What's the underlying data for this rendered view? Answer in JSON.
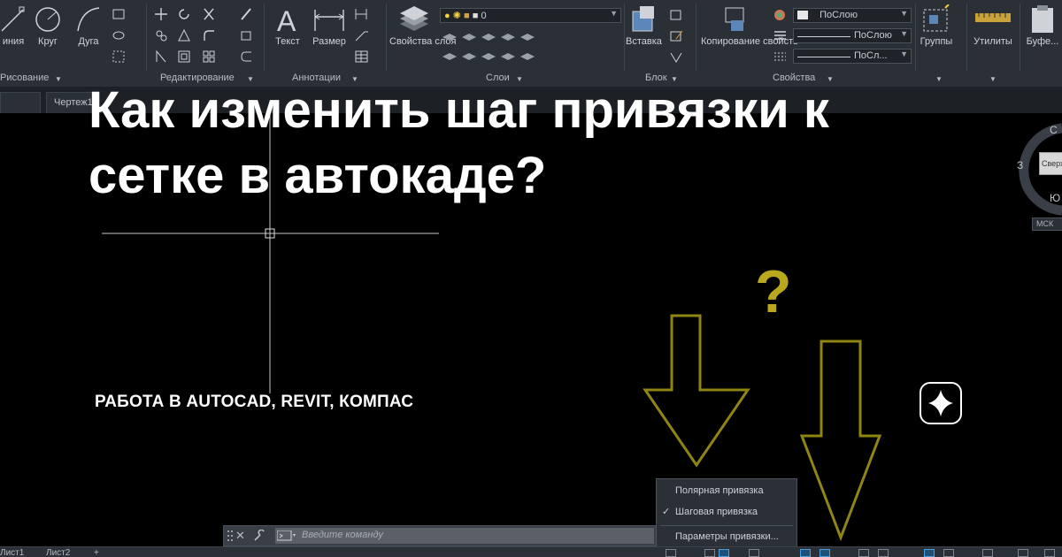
{
  "ribbon": {
    "tools": {
      "line_partial": "иния",
      "circle": "Круг",
      "arc": "Дуга",
      "text": "Текст",
      "dimension": "Размер",
      "layer_properties": "Свойства слоя",
      "insert": "Вставка",
      "match_properties": "Копирование свойств",
      "groups": "Группы",
      "utilities": "Утилиты",
      "clipboard_partial": "Буфе..."
    },
    "panels": {
      "draw": "Рисование",
      "modify": "Редактирование",
      "annotation": "Аннотации",
      "layers": "Слои",
      "block": "Блок",
      "properties": "Свойства"
    },
    "layer_combo_value": "0",
    "color_combo": "ПоСлою",
    "linetype_combo": "ПоСлою",
    "lineweight_combo": "ПоСл..."
  },
  "tabs": {
    "drawing_tab": "Чертеж1"
  },
  "headline": {
    "line1": "Как изменить шаг привязки к",
    "line2": "сетке в автокаде?"
  },
  "subtitle": "РАБОТА В AUTOCAD, REVIT, КОМПАС",
  "viewcube": {
    "north": "С",
    "west": "З",
    "south": "Ю",
    "top_face": "Сверх",
    "ucs": "МСК"
  },
  "question_mark": "?",
  "context_menu": {
    "items": [
      {
        "label": "Полярная привязка",
        "checked": false
      },
      {
        "label": "Шаговая привязка",
        "checked": true
      },
      {
        "label": "Параметры привязки...",
        "checked": false
      }
    ],
    "check_glyph": "✓"
  },
  "command_line": {
    "placeholder": "Введите команду"
  },
  "status_bar": {
    "layout1": "Лист1",
    "layout2": "Лист2",
    "add": "+"
  },
  "colors": {
    "ribbon_bg": "#2b2f36",
    "canvas_bg": "#000000",
    "arrow_outline": "#8f8513",
    "question_mark": "#b9a81d",
    "crosshair": "#c8c8c8",
    "headline": "#ffffff"
  },
  "icons": {
    "badge": "sparkle-icon"
  }
}
